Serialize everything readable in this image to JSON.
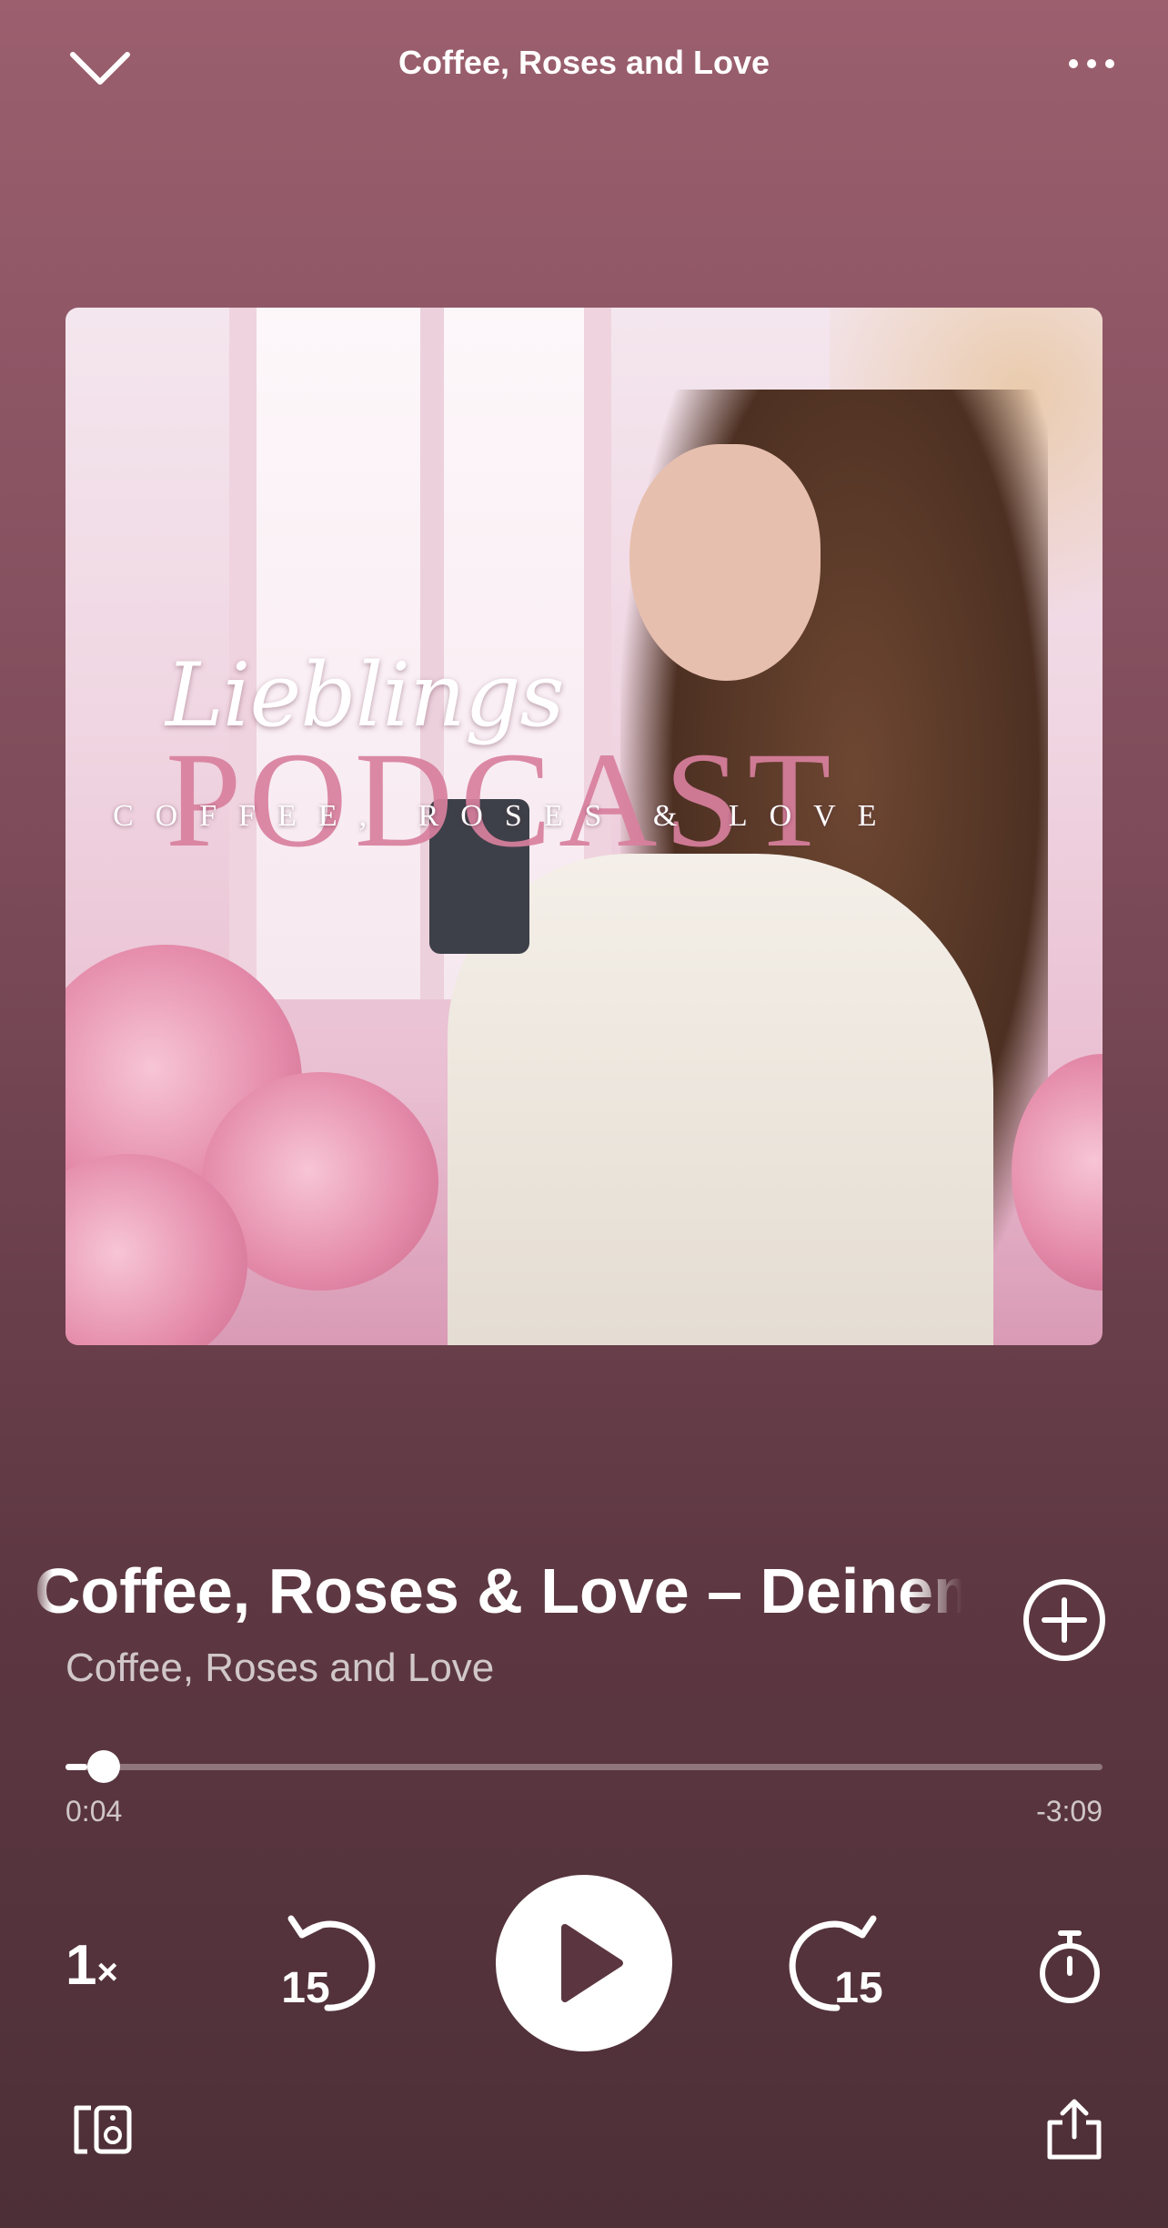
{
  "header": {
    "title": "Coffee, Roses and Love"
  },
  "artwork": {
    "logo_script": "Lieblings",
    "logo_main": "PODCAST",
    "logo_sub": "COFFEE, ROSES & LOVE"
  },
  "episode": {
    "title": "Coffee, Roses & Love – Deinem Lieblingspodcast",
    "show": "Coffee, Roses and Love"
  },
  "playback": {
    "elapsed": "0:04",
    "remaining": "-3:09",
    "progress_fraction": 0.021,
    "speed_value": "1",
    "speed_suffix": "×",
    "skip_back_seconds": "15",
    "skip_forward_seconds": "15"
  },
  "colors": {
    "background_top": "#9b5f6e",
    "background_bottom": "#4d2f37",
    "accent": "#ffffff"
  },
  "icons": {
    "collapse": "chevron-down-icon",
    "more": "more-horizontal-icon",
    "add": "plus-circle-icon",
    "play": "play-icon",
    "skip_back": "rotate-ccw-15-icon",
    "skip_forward": "rotate-cw-15-icon",
    "sleep_timer": "stopwatch-icon",
    "devices": "devices-icon",
    "share": "share-icon"
  }
}
